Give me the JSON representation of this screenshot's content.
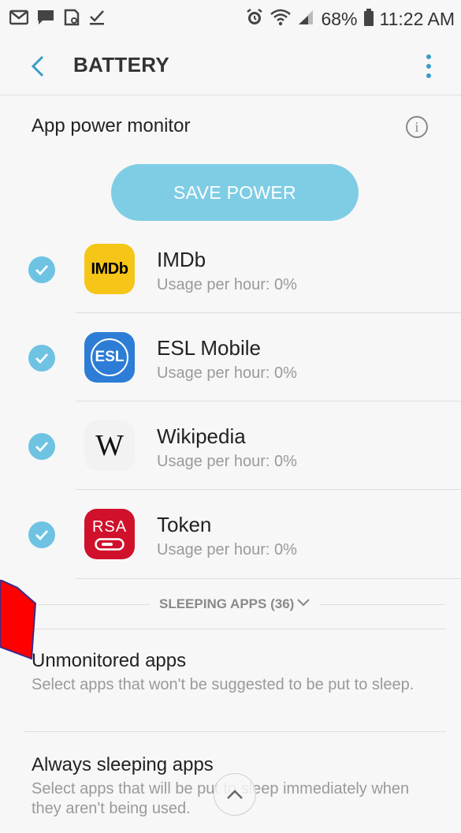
{
  "status_bar": {
    "battery_percent": "68%",
    "time": "11:22 AM"
  },
  "app_bar": {
    "title": "BATTERY"
  },
  "power_monitor": {
    "title": "App power monitor",
    "save_button": "SAVE POWER"
  },
  "apps": [
    {
      "name": "IMDb",
      "usage": "Usage per hour: 0%",
      "icon_text": "IMDb",
      "checked": true
    },
    {
      "name": "ESL Mobile",
      "usage": "Usage per hour: 0%",
      "icon_text": "ESL",
      "checked": true
    },
    {
      "name": "Wikipedia",
      "usage": "Usage per hour: 0%",
      "icon_text": "W",
      "checked": true
    },
    {
      "name": "Token",
      "usage": "Usage per hour: 0%",
      "icon_text": "RSA",
      "checked": true
    }
  ],
  "sleeping_apps": {
    "label": "SLEEPING APPS (36)"
  },
  "preferences": [
    {
      "title": "Unmonitored apps",
      "description": "Select apps that won't be suggested to be put to sleep."
    },
    {
      "title": "Always sleeping apps",
      "description": "Select apps that will be put to sleep immediately when they aren't being used."
    }
  ],
  "colors": {
    "accent": "#3a9dc9",
    "save_button": "#7fcde4",
    "check": "#6ec3e3",
    "annotation_arrow": "#ff0000"
  }
}
